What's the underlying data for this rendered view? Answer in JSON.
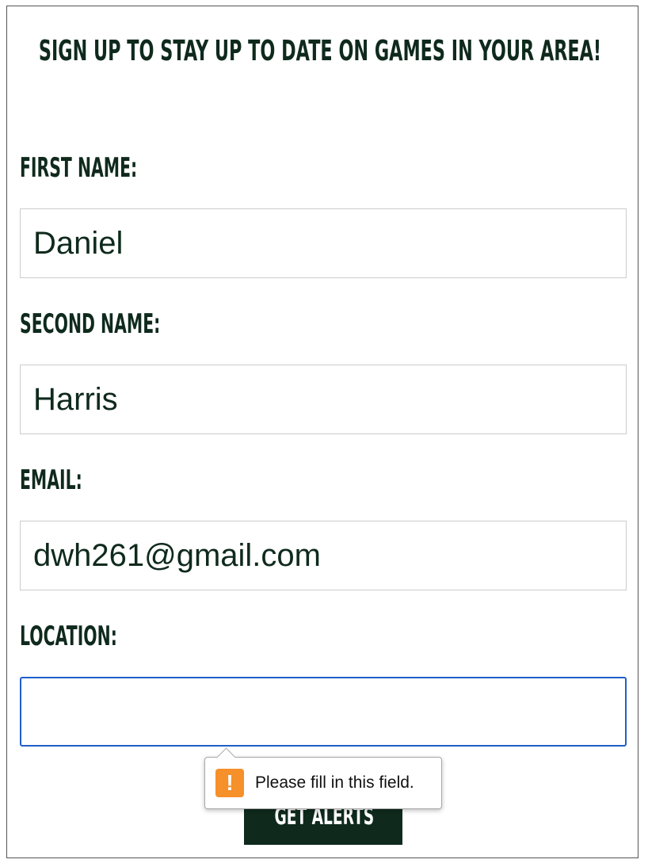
{
  "form": {
    "heading": "Sign up to stay up to date on games in your area!",
    "fields": [
      {
        "label": "First Name:",
        "value": "Daniel"
      },
      {
        "label": "Second Name:",
        "value": "Harris"
      },
      {
        "label": "Email:",
        "value": "dwh261@gmail.com"
      },
      {
        "label": "Location:",
        "value": ""
      }
    ],
    "submit_label": "Get Alerts"
  },
  "validation": {
    "message": "Please fill in this field.",
    "icon": "warning-icon",
    "icon_glyph": "!"
  },
  "colors": {
    "brand_dark_green": "#0f2a1d",
    "focus_blue": "#1f5fc9",
    "warning_orange": "#f5902a"
  }
}
